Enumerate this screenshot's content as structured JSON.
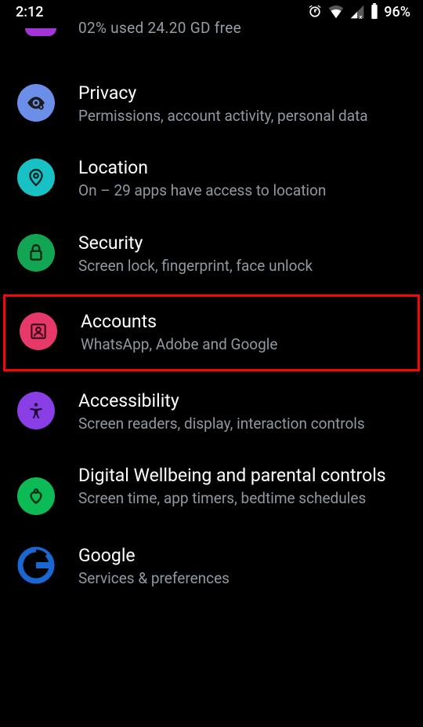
{
  "status": {
    "time": "2:12",
    "battery": "96%"
  },
  "storage_partial_line": "02% used     24.20 GD free",
  "items": [
    {
      "title": "Privacy",
      "subtitle": "Permissions, account activity, personal data",
      "iconColor": "#6b8fe9",
      "icon": "eye",
      "highlighted": false
    },
    {
      "title": "Location",
      "subtitle": "On – 29 apps have access to location",
      "iconColor": "#18c1c4",
      "icon": "pin",
      "highlighted": false
    },
    {
      "title": "Security",
      "subtitle": "Screen lock, fingerprint, face unlock",
      "iconColor": "#12a553",
      "icon": "lock",
      "highlighted": false
    },
    {
      "title": "Accounts",
      "subtitle": "WhatsApp, Adobe and Google",
      "iconColor": "#e6396a",
      "icon": "account",
      "highlighted": true
    },
    {
      "title": "Accessibility",
      "subtitle": "Screen readers, display, interaction controls",
      "iconColor": "#8a3ee6",
      "icon": "a11y",
      "highlighted": false
    },
    {
      "title": "Digital Wellbeing and parental controls",
      "subtitle": "Screen time, app timers, bedtime schedules",
      "iconColor": "#0dbb56",
      "icon": "heart",
      "highlighted": false
    },
    {
      "title": "Google",
      "subtitle": "Services & preferences",
      "iconColor": "#1967d2",
      "icon": "google",
      "highlighted": false
    }
  ]
}
